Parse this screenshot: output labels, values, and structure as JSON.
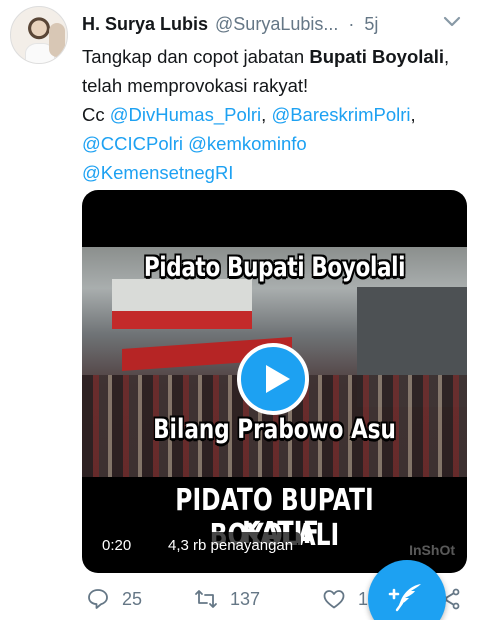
{
  "tweet": {
    "author_name": "H. Surya Lubis",
    "author_handle": "@SuryaLubis...",
    "dot": "·",
    "time": "5j",
    "text_before": "Tangkap dan copot jabatan ",
    "text_bold": "Bupati Boyolali",
    "text_after": ", telah memprovokasi rakyat!",
    "cc_label": "Cc ",
    "mention_1": "@DivHumas_Polri",
    "sep_1": ", ",
    "mention_2": "@BareskrimPolri",
    "sep_2": ",",
    "mention_3": "@CCICPolri",
    "mention_4": "@kemkominfo",
    "mention_5": "@KemensetnegRI"
  },
  "video": {
    "caption_top": "Pidato Bupati Boyolali",
    "caption_mid": "Bilang Prabowo Asu",
    "caption_bottom_1": "PIDATO BUPATI BOYOLALI",
    "caption_bottom_2": "KATIF",
    "watermark": "InShOt",
    "duration": "0:20",
    "views": "4,3 rb penayangan"
  },
  "actions": {
    "replies": "25",
    "retweets": "137",
    "likes": "1"
  },
  "colors": {
    "accent": "#1da1f2",
    "muted": "#657786",
    "text": "#14171a"
  },
  "icons": [
    "chevron-down-icon",
    "reply-icon",
    "retweet-icon",
    "like-icon",
    "share-icon",
    "compose-icon",
    "play-icon"
  ]
}
